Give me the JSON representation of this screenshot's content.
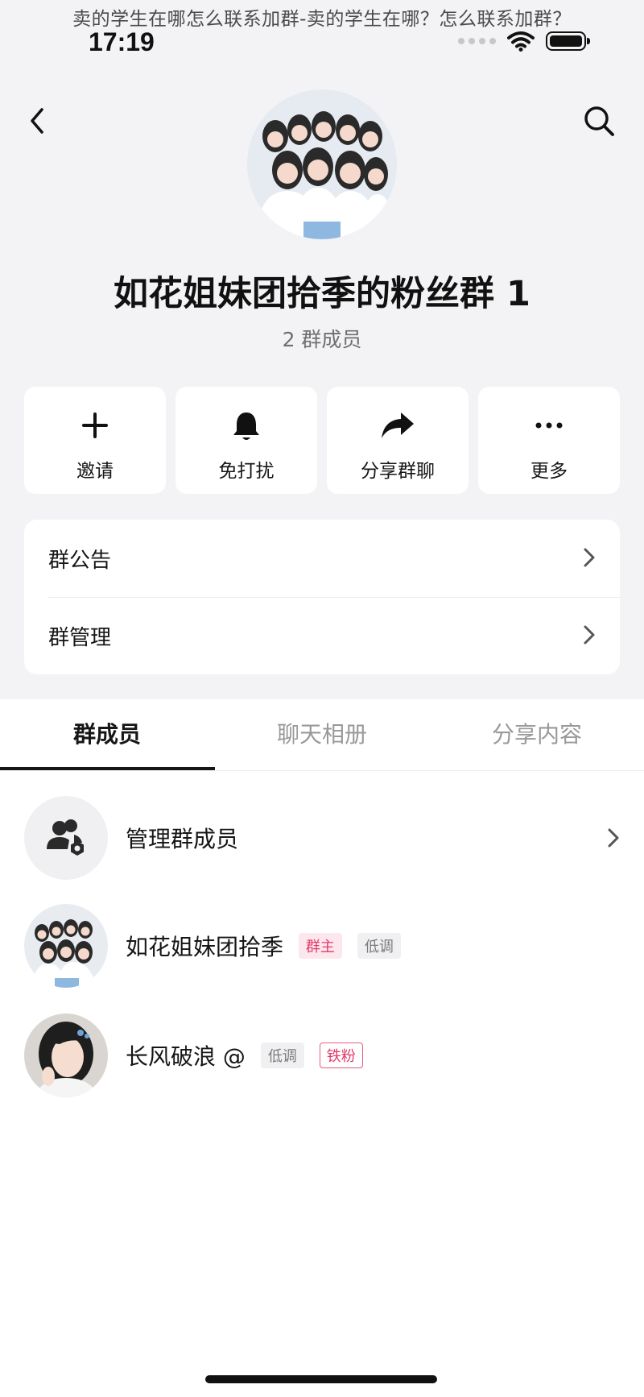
{
  "caption": "卖的学生在哪怎么联系加群-卖的学生在哪？怎么联系加群？",
  "status_bar": {
    "time": "17:19"
  },
  "header": {
    "back_icon": "chevron-left-icon",
    "search_icon": "search-icon"
  },
  "group": {
    "name": "如花姐妹团拾季的粉丝群 1",
    "member_count": "2 群成员"
  },
  "actions": [
    {
      "label": "邀请",
      "icon": "plus-icon"
    },
    {
      "label": "免打扰",
      "icon": "bell-icon"
    },
    {
      "label": "分享群聊",
      "icon": "share-arrow-icon"
    },
    {
      "label": "更多",
      "icon": "more-dots-icon"
    }
  ],
  "menu": [
    {
      "label": "群公告"
    },
    {
      "label": "群管理"
    }
  ],
  "tabs": [
    {
      "label": "群成员",
      "active": true
    },
    {
      "label": "聊天相册",
      "active": false
    },
    {
      "label": "分享内容",
      "active": false
    }
  ],
  "manage_row": {
    "label": "管理群成员",
    "icon": "users-settings-icon"
  },
  "members": [
    {
      "name": "如花姐妹团拾季",
      "badges": [
        {
          "text": "群主",
          "style": "owner"
        },
        {
          "text": "低调",
          "style": "low"
        }
      ]
    },
    {
      "name": "长风破浪 @",
      "badges": [
        {
          "text": "低调",
          "style": "low"
        },
        {
          "text": "铁粉",
          "style": "fan"
        }
      ]
    }
  ],
  "colors": {
    "background": "#f3f3f5",
    "accent_pink": "#e03a6a",
    "text": "#161616"
  }
}
